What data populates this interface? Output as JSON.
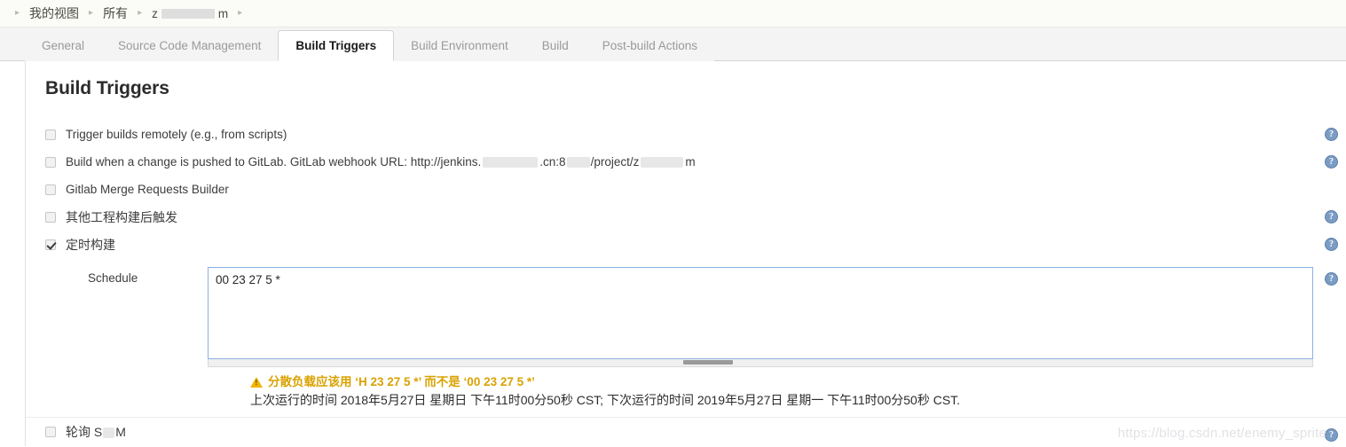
{
  "breadcrumb": {
    "items": [
      {
        "label": "我的视图",
        "redacted": false
      },
      {
        "label": "所有",
        "redacted": false
      },
      {
        "label": "z",
        "suffix": "m",
        "redacted": true
      }
    ],
    "separator": "▸"
  },
  "tabs": [
    {
      "label": "General",
      "active": false
    },
    {
      "label": "Source Code Management",
      "active": false
    },
    {
      "label": "Build Triggers",
      "active": true
    },
    {
      "label": "Build Environment",
      "active": false
    },
    {
      "label": "Build",
      "active": false
    },
    {
      "label": "Post-build Actions",
      "active": false
    }
  ],
  "page": {
    "title": "Build Triggers"
  },
  "triggers": [
    {
      "label": "Trigger builds remotely (e.g., from scripts)",
      "checked": false,
      "help": true,
      "chinese": false
    },
    {
      "label_prefix": "Build when a change is pushed to GitLab. GitLab webhook URL: http://jenkins.",
      "label_mid": ".cn:8",
      "label_mid2": "/project/z",
      "label_suffix": "m",
      "checked": false,
      "help": true,
      "chinese": false,
      "has_redactions": true
    },
    {
      "label": "Gitlab Merge Requests Builder",
      "checked": false,
      "help": false,
      "chinese": false
    },
    {
      "label": "其他工程构建后触发",
      "checked": false,
      "help": true,
      "chinese": true
    },
    {
      "label": "定时构建",
      "checked": true,
      "help": true,
      "chinese": true
    }
  ],
  "schedule": {
    "label": "Schedule",
    "value": "00 23 27 5 *",
    "help": true,
    "warning": "分散负载应该用 ‘H 23 27 5 *’ 而不是 ‘00 23 27 5 *’",
    "info": "上次运行的时间 2018年5月27日 星期日 下午11时00分50秒 CST; 下次运行的时间 2019年5月27日 星期一 下午11时00分50秒 CST."
  },
  "bottom_trigger": {
    "label_prefix": "轮询 S",
    "label_suffix": "M",
    "checked": false,
    "help": true
  },
  "watermark": "https://blog.csdn.net/enemy_sprite",
  "icons": {
    "help": "?"
  },
  "colors": {
    "tab_active_text": "#1a1a1a",
    "tab_inactive_text": "#9a9a9a",
    "warning": "#d9a200",
    "help_icon": "#7b9cc4",
    "textarea_border": "#8cb0e0",
    "breadcrumb_bg": "#fbfcf7"
  }
}
